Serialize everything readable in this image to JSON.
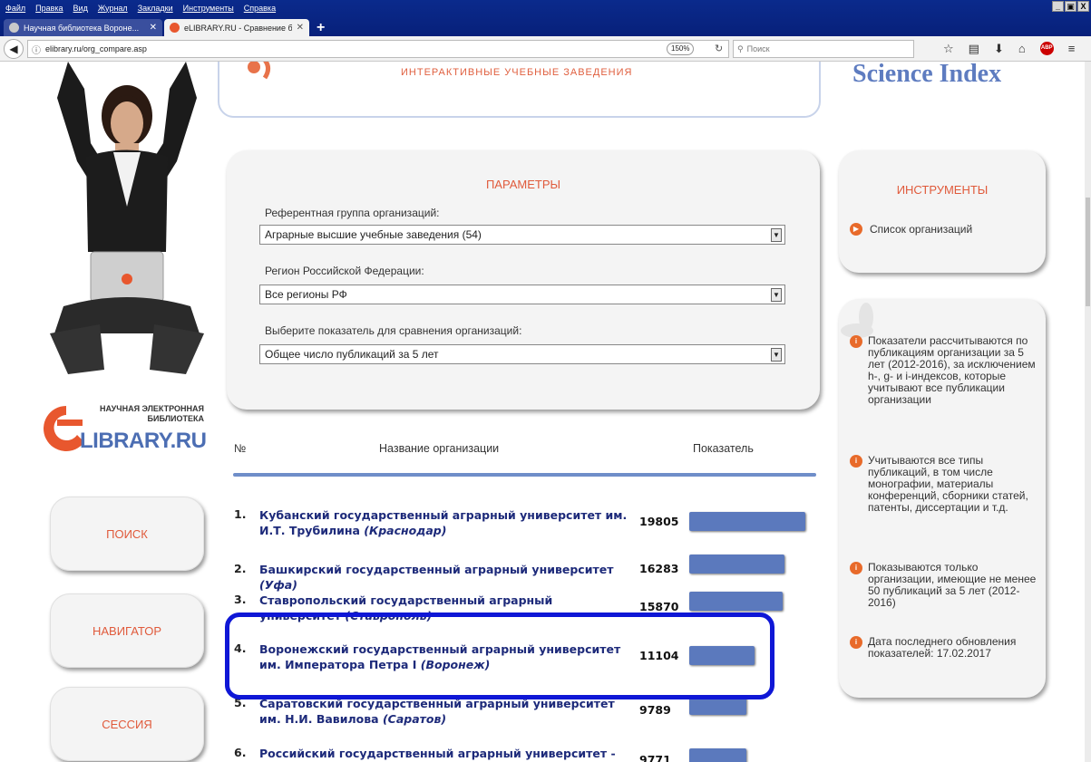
{
  "browser": {
    "menu": [
      "Файл",
      "Правка",
      "Вид",
      "Журнал",
      "Закладки",
      "Инструменты",
      "Справка"
    ],
    "window_controls": [
      "_",
      "▣",
      "X"
    ],
    "tabs": [
      {
        "title": "Научная библиотека Вороне...",
        "active": false
      },
      {
        "title": "eLIBRARY.RU - Сравнение б...",
        "active": true
      }
    ],
    "url": "elibrary.ru/org_compare.asp",
    "zoom": "150%",
    "search_placeholder": "Поиск"
  },
  "header": {
    "science_index_logo": "Science Index",
    "banner_text": "ИНТЕРАКТИВНЫЕ УЧЕБНЫЕ ЗАВЕДЕНИЯ"
  },
  "logo": {
    "small_line1": "НАУЧНАЯ ЭЛЕКТРОННАЯ",
    "small_line2": "БИБЛИОТЕКА",
    "big": "LIBRARY.RU"
  },
  "side_nav": [
    "ПОИСК",
    "НАВИГАТОР",
    "СЕССИЯ"
  ],
  "params": {
    "title": "ПАРАМЕТРЫ",
    "ref_group_label": "Референтная группа организаций:",
    "ref_group_value": "Аграрные высшие учебные заведения (54)",
    "region_label": "Регион Российской Федерации:",
    "region_value": "Все регионы РФ",
    "metric_label": "Выберите показатель для сравнения организаций:",
    "metric_value": "Общее число публикаций за 5 лет"
  },
  "tools": {
    "title": "ИНСТРУМЕНТЫ",
    "link": "Список организаций"
  },
  "info": [
    "Показатели рассчитываются по публикациям организации за 5 лет (2012-2016), за исключением h-, g- и i-индексов, которые учитывают все публикации организации",
    "Учитываются все типы публикаций, в том числе монографии, материалы конференций, сборники статей, патенты, диссертации и т.д.",
    "Показываются только организации, имеющие не менее 50 публикаций за 5 лет (2012-2016)",
    "Дата последнего обновления показателей: 17.02.2017"
  ],
  "table": {
    "col_num": "№",
    "col_name": "Название организации",
    "col_value": "Показатель",
    "max_value": 19805,
    "rows": [
      {
        "num": "1.",
        "name": "Кубанский государственный аграрный университет им. И.Т. Трубилина",
        "city": "(Краснодар)",
        "value": 19805
      },
      {
        "num": "2.",
        "name": "Башкирский государственный аграрный университет",
        "city": "(Уфа)",
        "value": 16283
      },
      {
        "num": "3.",
        "name": "Ставропольский государственный аграрный университет",
        "city": "(Ставрополь)",
        "value": 15870
      },
      {
        "num": "4.",
        "name": "Воронежский государственный аграрный университет им. Императора Петра I",
        "city": "(Воронеж)",
        "value": 11104
      },
      {
        "num": "5.",
        "name": "Саратовский государственный аграрный университет им. Н.И. Вавилова",
        "city": "(Саратов)",
        "value": 9789
      },
      {
        "num": "6.",
        "name": "Российский государственный аграрный университет - Московская",
        "city": "",
        "value": 9771
      }
    ]
  }
}
